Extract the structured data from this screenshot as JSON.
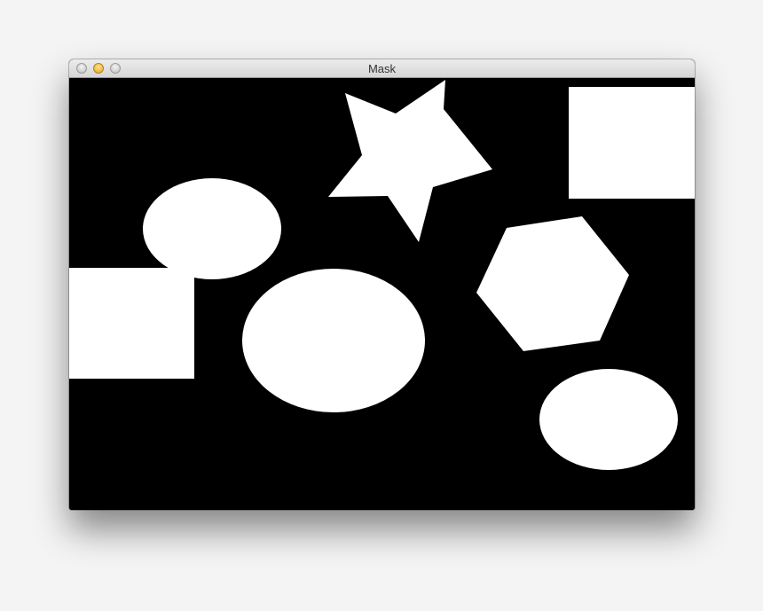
{
  "window": {
    "title": "Mask"
  },
  "title_bar": {
    "buttons": [
      {
        "name": "close-button",
        "icon": "close-icon"
      },
      {
        "name": "minimize-button",
        "icon": "minimize-icon"
      },
      {
        "name": "zoom-button",
        "icon": "zoom-icon"
      }
    ]
  },
  "mask_image": {
    "background_color": "#000000",
    "shape_color": "#ffffff",
    "shapes": [
      "star",
      "rectangle",
      "ellipse",
      "rectangle",
      "ellipse",
      "hexagon",
      "ellipse"
    ]
  }
}
